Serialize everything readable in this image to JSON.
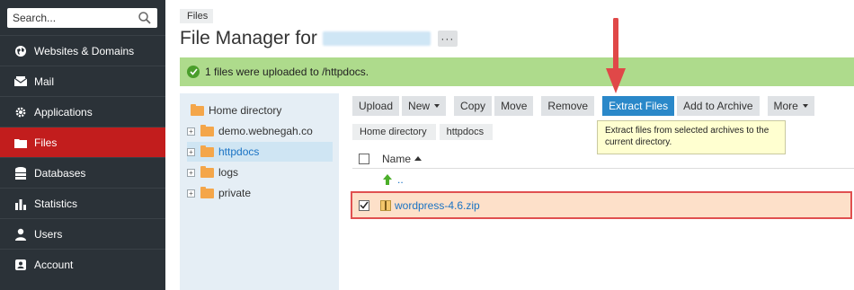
{
  "sidebar": {
    "search_placeholder": "Search...",
    "items": [
      {
        "label": "Websites & Domains",
        "icon": "globe-icon",
        "active": false
      },
      {
        "label": "Mail",
        "icon": "envelope-icon",
        "active": false
      },
      {
        "label": "Applications",
        "icon": "gear-icon",
        "active": false
      },
      {
        "label": "Files",
        "icon": "folder-icon",
        "active": true
      },
      {
        "label": "Databases",
        "icon": "database-icon",
        "active": false
      },
      {
        "label": "Statistics",
        "icon": "bar-chart-icon",
        "active": false
      },
      {
        "label": "Users",
        "icon": "user-icon",
        "active": false
      },
      {
        "label": "Account",
        "icon": "account-card-icon",
        "active": false
      }
    ]
  },
  "header": {
    "breadcrumb": "Files",
    "title": "File Manager for",
    "more_label": "···"
  },
  "alert": {
    "text": "1 files were uploaded to /httpdocs."
  },
  "tree": {
    "home_label": "Home directory",
    "folders": [
      {
        "label": "demo.webnegah.co",
        "selected": false,
        "link": false
      },
      {
        "label": "httpdocs",
        "selected": true,
        "link": true
      },
      {
        "label": "logs",
        "selected": false,
        "link": false
      },
      {
        "label": "private",
        "selected": false,
        "link": false
      }
    ]
  },
  "toolbar": {
    "upload": "Upload",
    "new": "New",
    "copy": "Copy",
    "move": "Move",
    "remove": "Remove",
    "extract": "Extract Files",
    "add_to_archive": "Add to Archive",
    "more": "More"
  },
  "path": {
    "segments": [
      "Home directory",
      "httpdocs"
    ]
  },
  "tooltip": {
    "text": "Extract files from selected archives to the current directory."
  },
  "table": {
    "column_name": "Name",
    "up_label": "..",
    "rows": [
      {
        "name": "wordpress-4.6.zip",
        "checked": true
      }
    ]
  },
  "colors": {
    "sidebar_bg": "#2b3238",
    "active_nav": "#c21d1d",
    "alert_bg": "#aedb8c",
    "primary_button": "#2a88c9",
    "highlight_border": "#e05050",
    "highlight_fill": "#fde0c9",
    "annotation_arrow": "#e04848"
  }
}
